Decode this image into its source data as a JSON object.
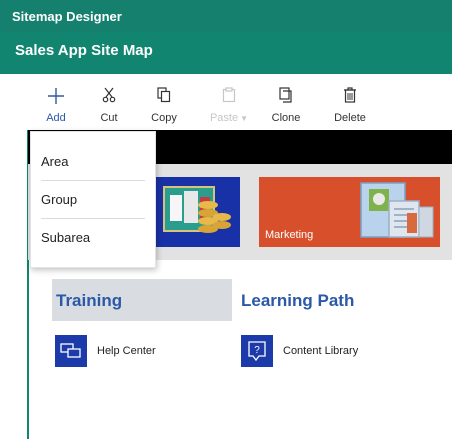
{
  "app": {
    "title": "Sitemap Designer"
  },
  "sitemap": {
    "title": "Sales App Site Map"
  },
  "toolbar": {
    "add": "Add",
    "cut": "Cut",
    "copy": "Copy",
    "paste": "Paste",
    "clone": "Clone",
    "delete": "Delete"
  },
  "add_menu": {
    "items": [
      "Area",
      "Group",
      "Subarea"
    ]
  },
  "tiles": {
    "marketing": "Marketing"
  },
  "groups": [
    {
      "title": "Training",
      "subarea": "Help Center",
      "icon": "help-center-icon"
    },
    {
      "title": "Learning Path",
      "subarea": "Content Library",
      "icon": "content-library-icon"
    }
  ],
  "colors": {
    "header": "#128571",
    "accent": "#2b59a8",
    "tile_blue": "#1931a6",
    "tile_orange": "#d7502b"
  }
}
